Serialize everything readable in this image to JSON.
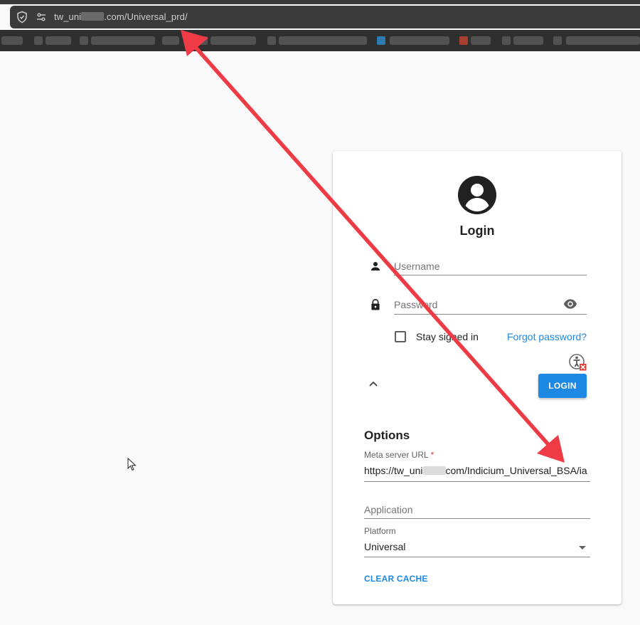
{
  "browser": {
    "url_prefix": "tw_uni",
    "url_suffix": ".com/Universal_prd/",
    "icons": [
      "shield-icon",
      "site-settings-icon"
    ]
  },
  "login": {
    "title": "Login",
    "username_placeholder": "Username",
    "password_placeholder": "Password",
    "stay_signed_in": "Stay signed in",
    "forgot_password": "Forgot password?",
    "login_button": "LOGIN",
    "icons": [
      "account-circle-icon",
      "person-icon",
      "lock-icon",
      "eye-icon",
      "chevron-up-icon",
      "accessibility-error-icon"
    ]
  },
  "options": {
    "title": "Options",
    "meta_server_label": "Meta server URL",
    "required_mark": "*",
    "meta_server_prefix": "https://tw_uni",
    "meta_server_suffix": "com/Indicium_Universal_BSA/ia",
    "application_placeholder": "Application",
    "platform_label": "Platform",
    "platform_value": "Universal",
    "clear_cache": "CLEAR CACHE"
  },
  "colors": {
    "accent": "#1e88e5",
    "arrow": "#ef3b45",
    "required": "#e53935"
  }
}
